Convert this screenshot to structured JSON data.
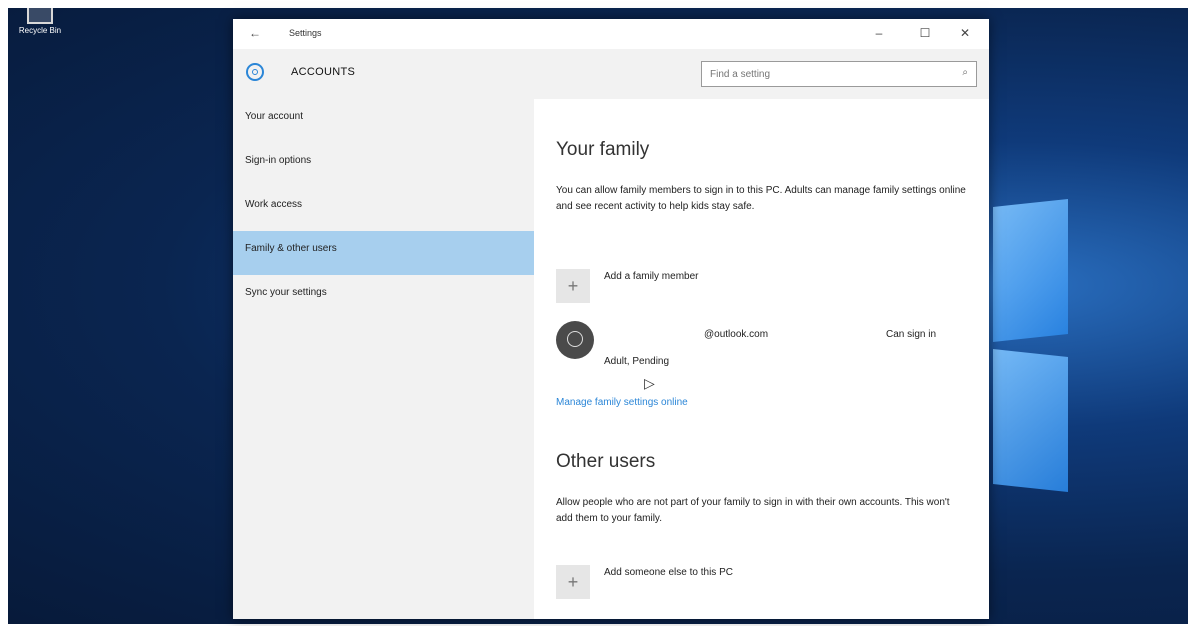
{
  "desktop": {
    "recycle_bin_label": "Recycle Bin"
  },
  "window": {
    "title": "Settings",
    "controls": {
      "minimize": "–",
      "maximize": "☐",
      "close": "✕"
    }
  },
  "header": {
    "heading": "ACCOUNTS",
    "search_placeholder": "Find a setting"
  },
  "sidebar": {
    "items": [
      {
        "label": "Your account"
      },
      {
        "label": "Sign-in options"
      },
      {
        "label": "Work access"
      },
      {
        "label": "Family & other users",
        "selected": true
      },
      {
        "label": "Sync your settings"
      }
    ]
  },
  "family": {
    "title": "Your family",
    "description": "You can allow family members to sign in to this PC. Adults can manage family settings online and see recent activity to help kids stay safe.",
    "add_label": "Add a family member",
    "member": {
      "email": "@outlook.com",
      "status": "Can sign in",
      "role": "Adult, Pending"
    },
    "manage_link": "Manage family settings online"
  },
  "other_users": {
    "title": "Other users",
    "description": "Allow people who are not part of your family to sign in with their own accounts. This won't add them to your family.",
    "add_label": "Add someone else to this PC"
  },
  "icons": {
    "back": "back-arrow-icon",
    "settings": "gear-icon",
    "search": "search-icon",
    "add": "plus-icon",
    "avatar": "person-icon"
  },
  "colors": {
    "accent": "#2b86d7",
    "selected_nav": "#a7cfee",
    "sidebar_bg": "#f2f2f2"
  }
}
